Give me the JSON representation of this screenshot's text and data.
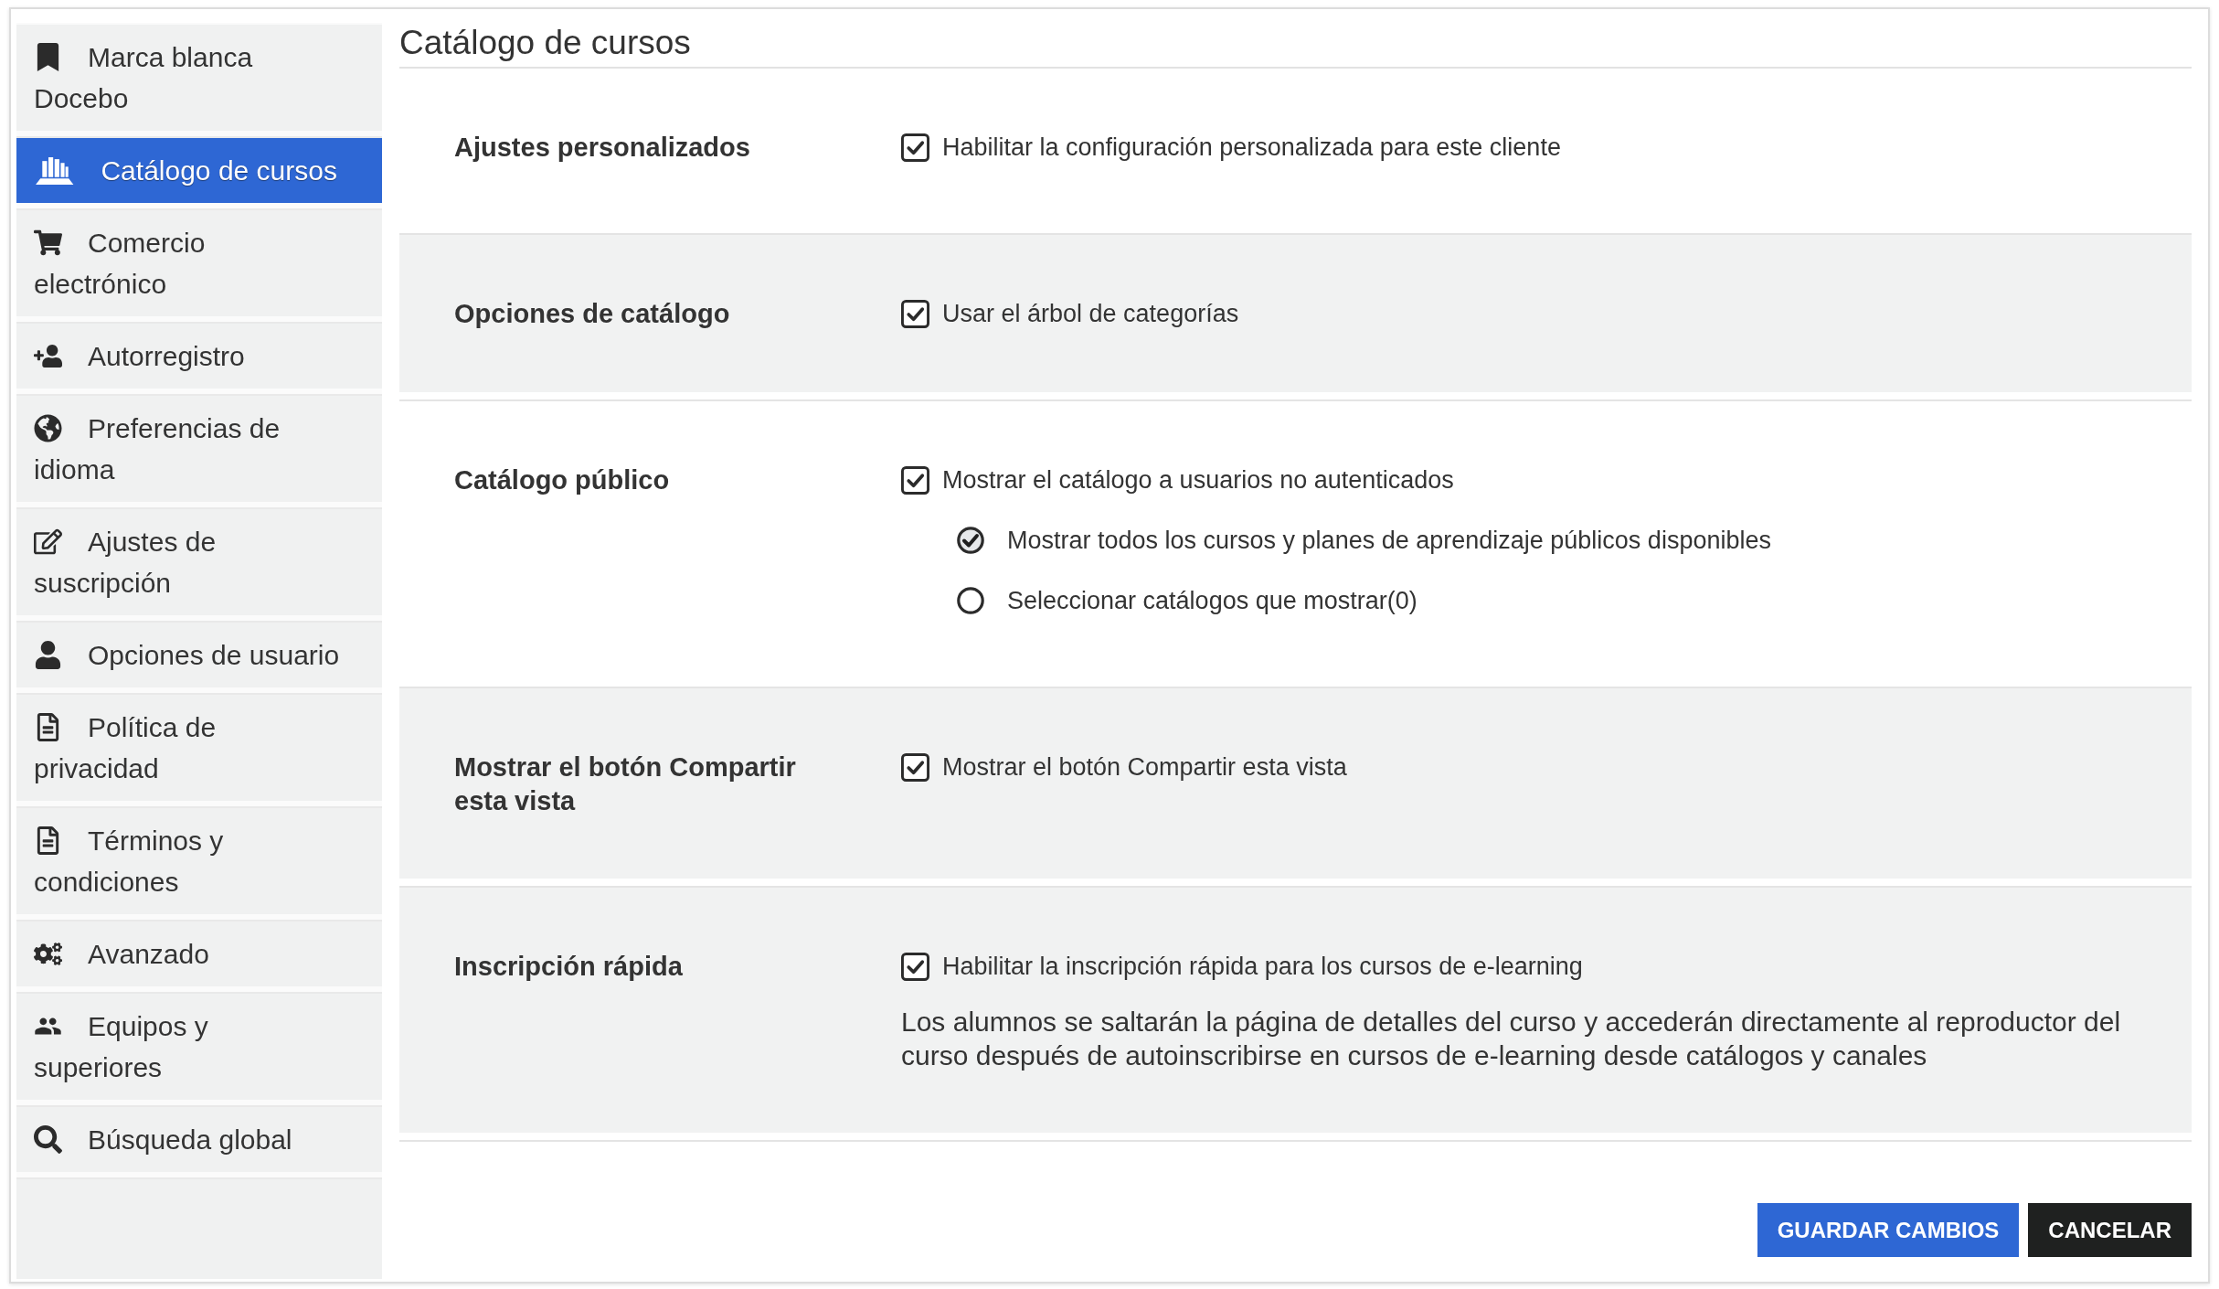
{
  "sidebar": {
    "items": [
      {
        "label": "Marca blanca Docebo",
        "selected": false
      },
      {
        "label": "Catálogo de cursos",
        "selected": true
      },
      {
        "label": "Comercio electrónico",
        "selected": false
      },
      {
        "label": "Autorregistro",
        "selected": false
      },
      {
        "label": "Preferencias de idioma",
        "selected": false
      },
      {
        "label": "Ajustes de suscripción",
        "selected": false
      },
      {
        "label": "Opciones de usuario",
        "selected": false
      },
      {
        "label": "Política de privacidad",
        "selected": false
      },
      {
        "label": "Términos y condiciones",
        "selected": false
      },
      {
        "label": "Avanzado",
        "selected": false
      },
      {
        "label": "Equipos y superiores",
        "selected": false
      },
      {
        "label": "Búsqueda global",
        "selected": false
      }
    ]
  },
  "page_title": "Catálogo de cursos",
  "sections": [
    {
      "label": "Ajustes personalizados",
      "shaded": false,
      "options": [
        {
          "kind": "checkbox",
          "label": "Habilitar la configuración personalizada para este cliente",
          "checked": true
        }
      ]
    },
    {
      "label": "Opciones de catálogo",
      "shaded": true,
      "options": [
        {
          "kind": "checkbox",
          "label": "Usar el árbol de categorías",
          "checked": true
        }
      ]
    },
    {
      "label": "Catálogo público",
      "shaded": false,
      "options": [
        {
          "kind": "checkbox",
          "label": "Mostrar el catálogo a usuarios no autenticados",
          "checked": true
        },
        {
          "kind": "radio",
          "label": "Mostrar todos los cursos y planes de aprendizaje públicos disponibles",
          "selected": true
        },
        {
          "kind": "radio",
          "label": "Seleccionar catálogos que mostrar(0)",
          "selected": false
        }
      ]
    },
    {
      "label": "Mostrar el botón Compartir esta vista",
      "shaded": true,
      "options": [
        {
          "kind": "checkbox",
          "label": "Mostrar el botón Compartir esta vista",
          "checked": true
        }
      ]
    },
    {
      "label": "Inscripción rápida",
      "shaded": true,
      "options": [
        {
          "kind": "checkbox",
          "label": "Habilitar la inscripción rápida para los cursos de e-learning",
          "checked": true
        },
        {
          "kind": "note",
          "text": "Los alumnos se saltarán la página de detalles del curso y accederán directamente al reproductor del curso después de autoinscribirse en cursos de e-learning desde catálogos y canales"
        }
      ]
    }
  ],
  "buttons": [
    {
      "label": "GUARDAR CAMBIOS",
      "kind": "primary"
    },
    {
      "label": "CANCELAR",
      "kind": "secondary"
    }
  ]
}
